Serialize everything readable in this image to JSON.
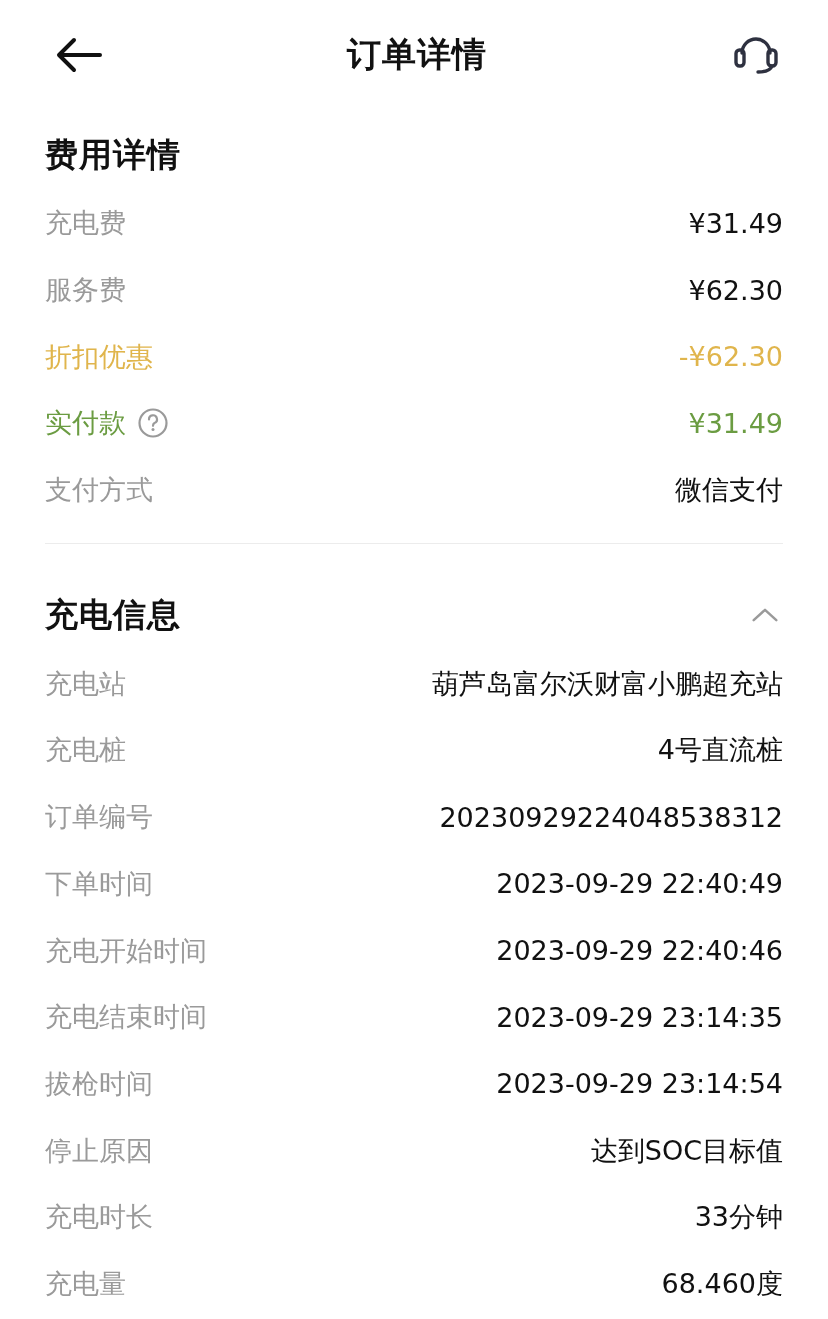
{
  "header": {
    "title": "订单详情"
  },
  "fee_details": {
    "title": "费用详情",
    "rows": [
      {
        "kind": "fee",
        "label": "充电费",
        "value": "¥31.49"
      },
      {
        "kind": "fee",
        "label": "服务费",
        "value": "¥62.30"
      },
      {
        "kind": "discount",
        "label": "折扣优惠",
        "value": "-¥62.30"
      },
      {
        "kind": "total",
        "label": "实付款",
        "value": "¥31.49"
      },
      {
        "kind": "fee",
        "label": "支付方式",
        "value": "微信支付"
      }
    ]
  },
  "charging_info": {
    "title": "充电信息",
    "expanded": true,
    "rows": [
      {
        "label": "充电站",
        "value": "葫芦岛富尔沃财富小鹏超充站"
      },
      {
        "label": "充电桩",
        "value": "4号直流桩"
      },
      {
        "label": "订单编号",
        "value": "20230929224048538312"
      },
      {
        "label": "下单时间",
        "value": "2023-09-29 22:40:49"
      },
      {
        "label": "充电开始时间",
        "value": "2023-09-29 22:40:46"
      },
      {
        "label": "充电结束时间",
        "value": "2023-09-29 23:14:35"
      },
      {
        "label": "拔枪时间",
        "value": "2023-09-29 23:14:54"
      },
      {
        "label": "停止原因",
        "value": "达到SOC目标值"
      },
      {
        "label": "充电时长",
        "value": "33分钟"
      },
      {
        "label": "充电量",
        "value": "68.460度"
      }
    ]
  }
}
